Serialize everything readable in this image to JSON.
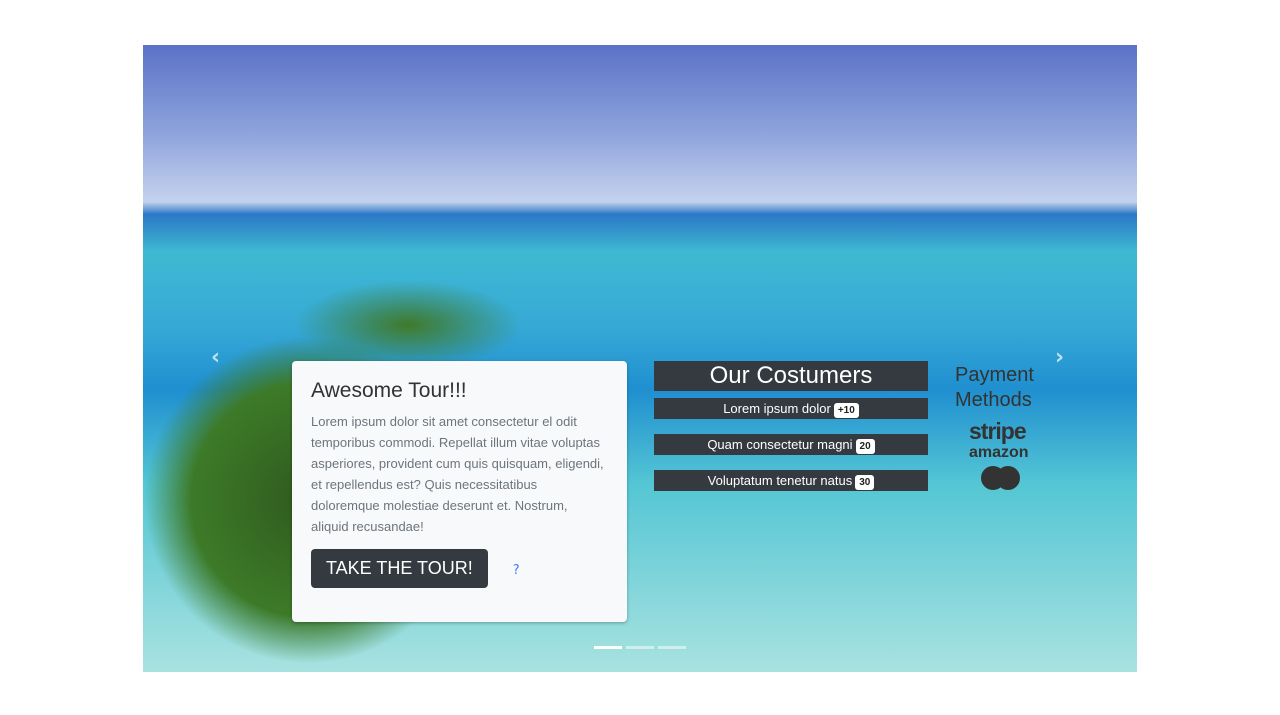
{
  "carousel": {
    "prev_icon": "chevron-left-icon",
    "next_icon": "chevron-right-icon",
    "prev": "‹",
    "next": "›",
    "slides": 3,
    "active": 0
  },
  "card": {
    "title": "Awesome Tour!!!",
    "text": "Lorem ipsum dolor sit amet consectetur el odit temporibus commodi. Repellat illum vitae voluptas asperiores, provident cum quis quisquam, eligendi, et repellendus est? Quis necessitatibus doloremque molestiae deserunt et. Nostrum, aliquid recusandae!",
    "button": "TAKE THE TOUR!",
    "help": "?"
  },
  "customers": {
    "title": "Our Costumers",
    "items": [
      {
        "label": "Lorem ipsum dolor",
        "badge": "+10"
      },
      {
        "label": "Quam consectetur magni",
        "badge": "20"
      },
      {
        "label": "Voluptatum tenetur natus",
        "badge": "30"
      }
    ]
  },
  "payment": {
    "title": "Payment Methods",
    "logos": [
      "stripe",
      "amazon",
      "mastercard"
    ]
  }
}
